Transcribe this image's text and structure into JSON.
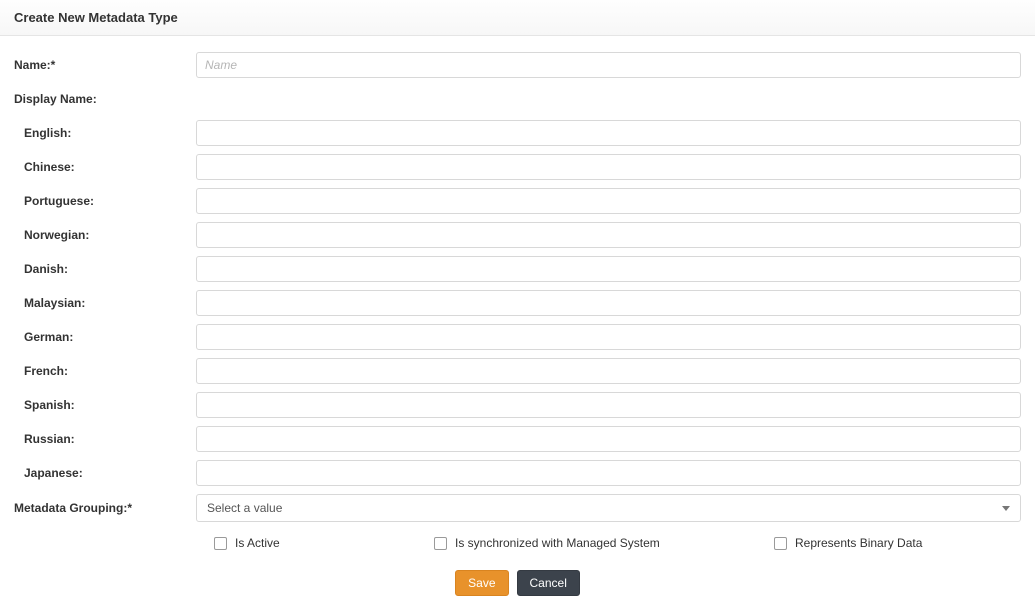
{
  "header": {
    "title": "Create New Metadata Type"
  },
  "form": {
    "name": {
      "label": "Name:*",
      "placeholder": "Name",
      "value": ""
    },
    "displayNameLabel": "Display Name:",
    "languages": [
      {
        "label": "English:",
        "value": ""
      },
      {
        "label": "Chinese:",
        "value": ""
      },
      {
        "label": "Portuguese:",
        "value": ""
      },
      {
        "label": "Norwegian:",
        "value": ""
      },
      {
        "label": "Danish:",
        "value": ""
      },
      {
        "label": "Malaysian:",
        "value": ""
      },
      {
        "label": "German:",
        "value": ""
      },
      {
        "label": "French:",
        "value": ""
      },
      {
        "label": "Spanish:",
        "value": ""
      },
      {
        "label": "Russian:",
        "value": ""
      },
      {
        "label": "Japanese:",
        "value": ""
      }
    ],
    "grouping": {
      "label": "Metadata Grouping:*",
      "placeholder": "Select a value"
    },
    "checks": {
      "isActive": "Is Active",
      "synced": "Is synchronized with Managed System",
      "binary": "Represents Binary Data"
    },
    "actions": {
      "save": "Save",
      "cancel": "Cancel"
    }
  }
}
